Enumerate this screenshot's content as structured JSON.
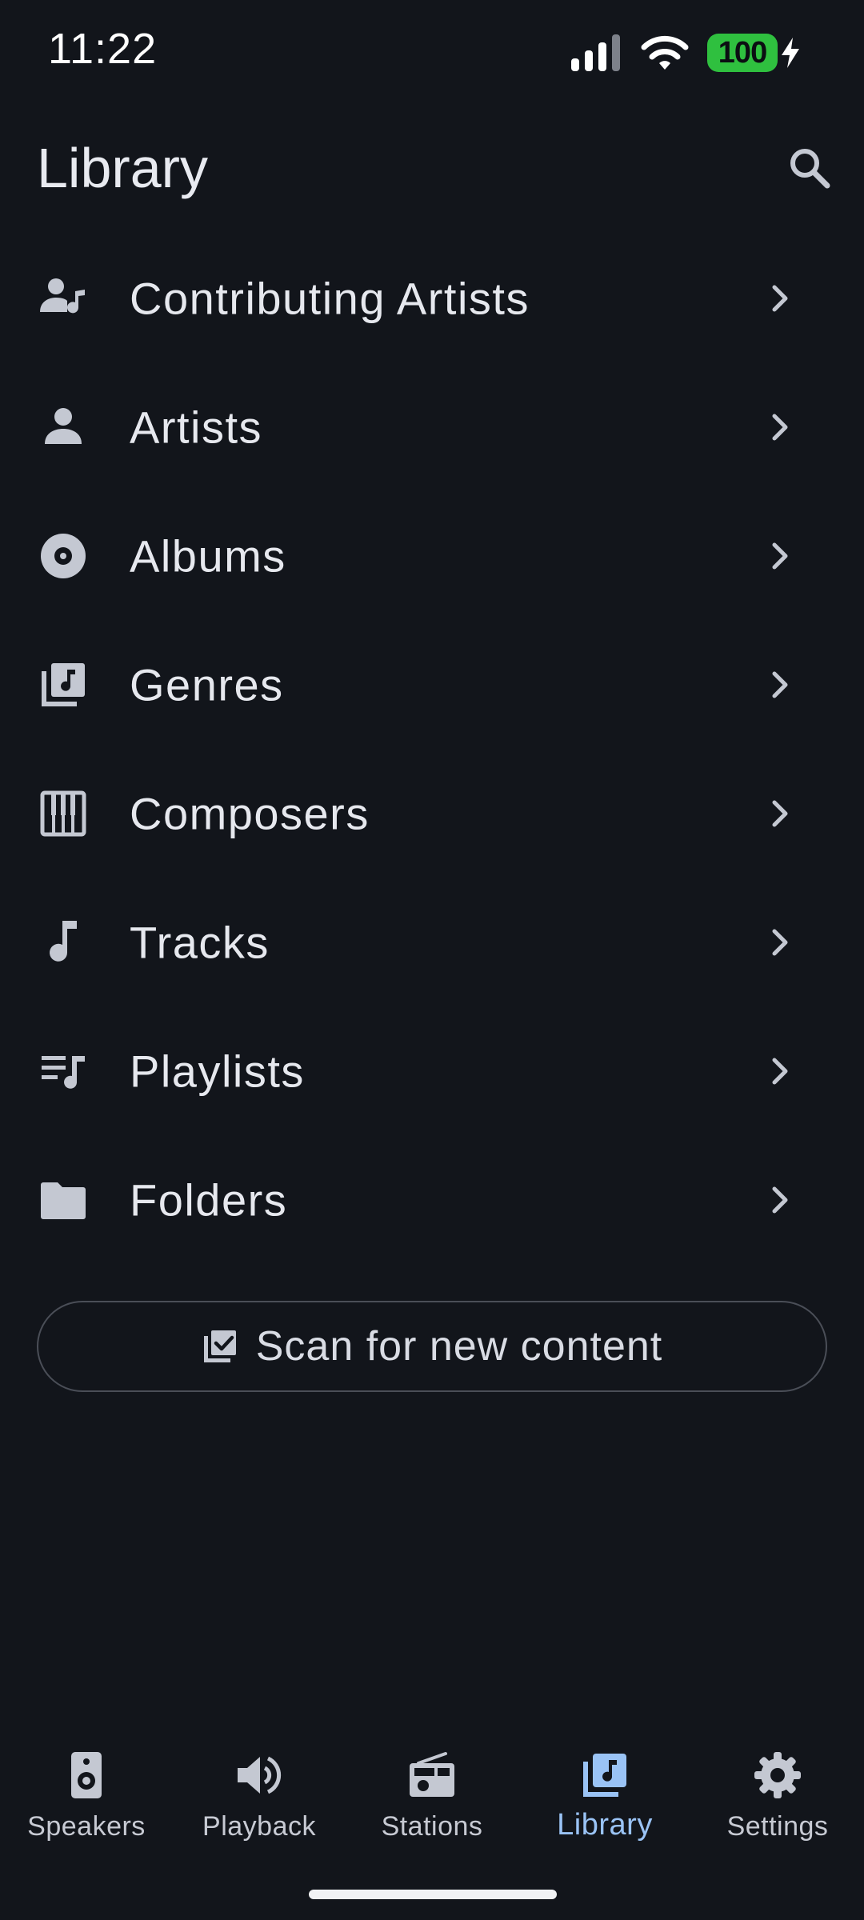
{
  "status_bar": {
    "time": "11:22",
    "battery": "100",
    "icons": [
      "signal-icon",
      "wifi-icon",
      "battery-icon",
      "charging-bolt-icon"
    ],
    "battery_color": "#2fc03f"
  },
  "header": {
    "title": "Library",
    "search_icon": "search-icon"
  },
  "library_items": [
    {
      "label": "Contributing Artists",
      "icon": "contributing-artists-icon"
    },
    {
      "label": "Artists",
      "icon": "person-icon"
    },
    {
      "label": "Albums",
      "icon": "album-icon"
    },
    {
      "label": "Genres",
      "icon": "genres-icon"
    },
    {
      "label": "Composers",
      "icon": "piano-icon"
    },
    {
      "label": "Tracks",
      "icon": "music-note-icon"
    },
    {
      "label": "Playlists",
      "icon": "playlist-icon"
    },
    {
      "label": "Folders",
      "icon": "folder-icon"
    }
  ],
  "scan_button": {
    "label": "Scan for new content",
    "icon": "scan-library-icon"
  },
  "bottom_nav": {
    "items": [
      {
        "label": "Speakers",
        "icon": "speaker-icon",
        "active": false
      },
      {
        "label": "Playback",
        "icon": "volume-icon",
        "active": false
      },
      {
        "label": "Stations",
        "icon": "radio-icon",
        "active": false
      },
      {
        "label": "Library",
        "icon": "library-icon",
        "active": true
      },
      {
        "label": "Settings",
        "icon": "gear-icon",
        "active": false
      }
    ]
  },
  "colors": {
    "background": "#12151b",
    "text": "#e6e8ee",
    "icon": "#c4c8d2",
    "accent": "#9ac3f5",
    "outline": "#4a4e57"
  }
}
